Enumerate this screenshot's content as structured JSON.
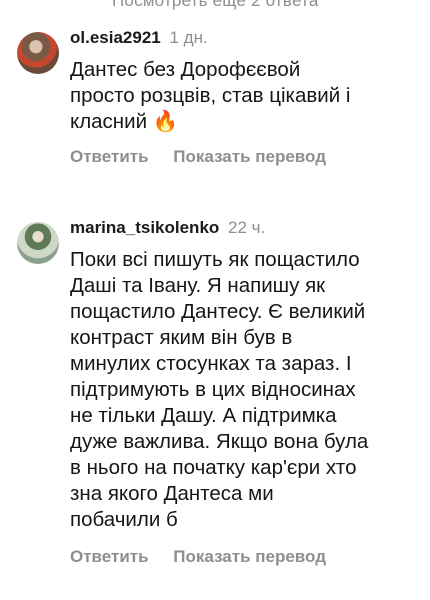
{
  "top_link": "Посмотреть ещё 2 ответа",
  "comments": [
    {
      "username": "ol.esia2921",
      "time": "1 дн.",
      "lines": [
        "Дантес без Дорофєєвой",
        "просто розцвів, став цікавий і",
        "класний"
      ],
      "emoji": "🔥",
      "reply_label": "Ответить",
      "translate_label": "Показать перевод"
    },
    {
      "username": "marina_tsikolenko",
      "time": "22 ч.",
      "lines": [
        "Поки всі пишуть як пощастило",
        "Даші та Івану. Я напишу як",
        "пощастило Дантесу. Є великий",
        "контраст яким він був в",
        "минулих стосунках та зараз. І",
        "підтримують в цих відносинах",
        "не тільки Дашу. А підтримка",
        "дуже важлива. Якщо вона була",
        "в нього на початку кар'єри хто",
        "зна якого Дантеса ми",
        "побачили б"
      ],
      "reply_label": "Ответить",
      "translate_label": "Показать перевод"
    }
  ]
}
